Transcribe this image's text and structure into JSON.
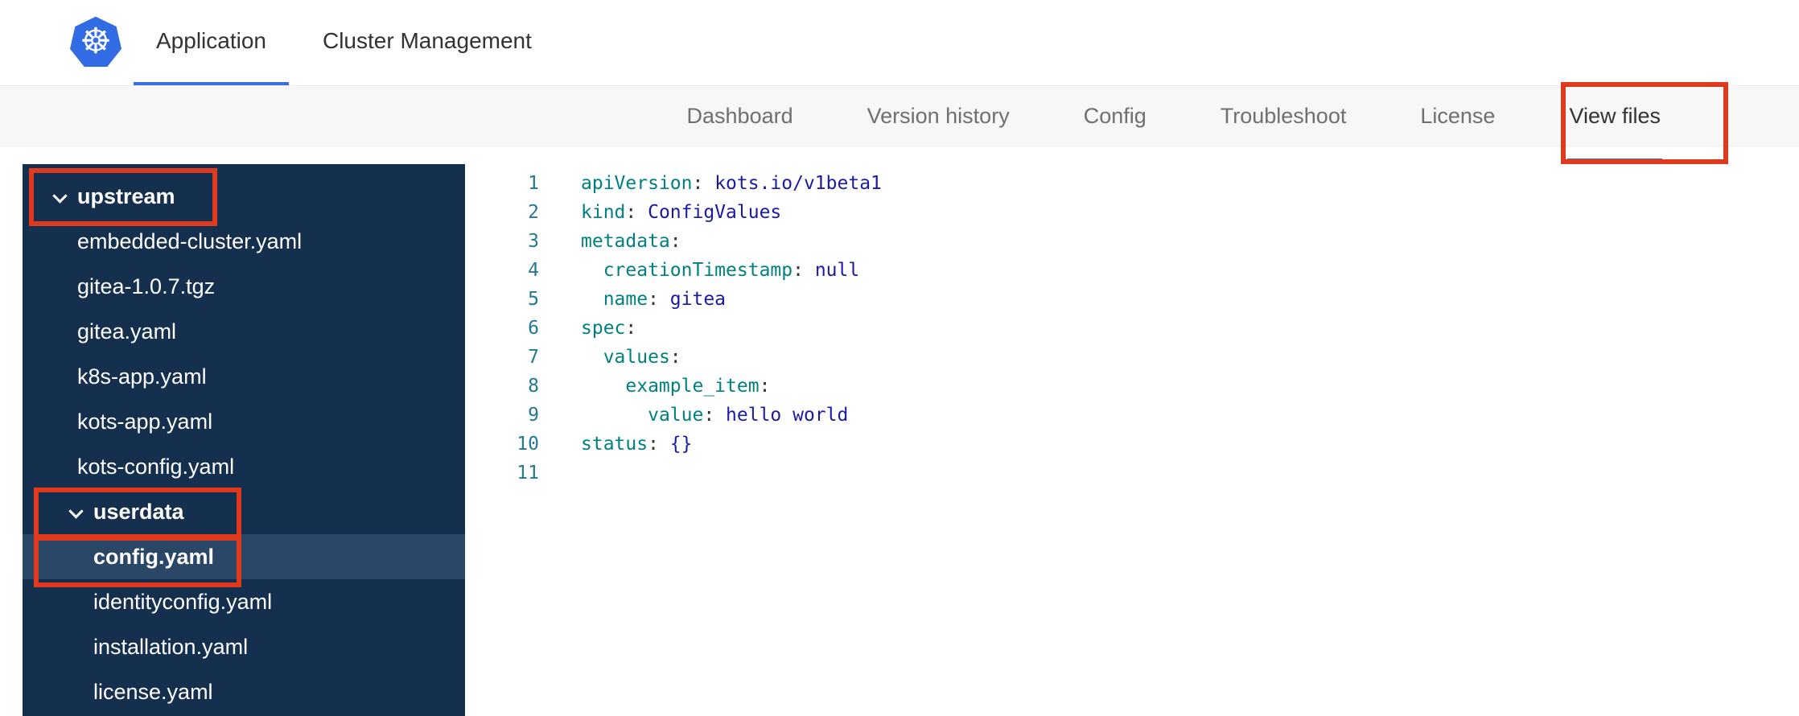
{
  "colors": {
    "accent_blue": "#3b6fe0",
    "annotation_red": "#e03a1e",
    "kubernetes_blue": "#326ce5",
    "sidebar_bg": "#15304f",
    "sidebar_selected": "#2a4768",
    "code_key": "#008080",
    "code_value": "#1a1aa6",
    "code_plain": "#333333",
    "line_number": "#237893"
  },
  "header": {
    "logo_glyph": "☸",
    "tabs": [
      {
        "label": "Application",
        "active": true
      },
      {
        "label": "Cluster Management",
        "active": false
      }
    ]
  },
  "subnav": {
    "tabs": [
      {
        "label": "Dashboard",
        "active": false
      },
      {
        "label": "Version history",
        "active": false
      },
      {
        "label": "Config",
        "active": false
      },
      {
        "label": "Troubleshoot",
        "active": false
      },
      {
        "label": "License",
        "active": false
      },
      {
        "label": "View files",
        "active": true,
        "annotated": true
      }
    ]
  },
  "file_tree": {
    "items": [
      {
        "type": "folder",
        "label": "upstream",
        "level": 0,
        "expanded": true,
        "annotated": true
      },
      {
        "type": "file",
        "label": "embedded-cluster.yaml",
        "level": 0
      },
      {
        "type": "file",
        "label": "gitea-1.0.7.tgz",
        "level": 0
      },
      {
        "type": "file",
        "label": "gitea.yaml",
        "level": 0
      },
      {
        "type": "file",
        "label": "k8s-app.yaml",
        "level": 0
      },
      {
        "type": "file",
        "label": "kots-app.yaml",
        "level": 0
      },
      {
        "type": "file",
        "label": "kots-config.yaml",
        "level": 0
      },
      {
        "type": "folder",
        "label": "userdata",
        "level": 1,
        "expanded": true,
        "annotated": true
      },
      {
        "type": "file",
        "label": "config.yaml",
        "level": 1,
        "selected": true,
        "annotated": true
      },
      {
        "type": "file",
        "label": "identityconfig.yaml",
        "level": 1
      },
      {
        "type": "file",
        "label": "installation.yaml",
        "level": 1
      },
      {
        "type": "file",
        "label": "license.yaml",
        "level": 1
      }
    ]
  },
  "editor": {
    "lines": [
      {
        "n": "1",
        "tokens": [
          {
            "t": "key",
            "v": "apiVersion"
          },
          {
            "t": "p",
            "v": ": "
          },
          {
            "t": "val",
            "v": "kots.io/v1beta1"
          }
        ]
      },
      {
        "n": "2",
        "tokens": [
          {
            "t": "key",
            "v": "kind"
          },
          {
            "t": "p",
            "v": ": "
          },
          {
            "t": "val",
            "v": "ConfigValues"
          }
        ]
      },
      {
        "n": "3",
        "tokens": [
          {
            "t": "key",
            "v": "metadata"
          },
          {
            "t": "p",
            "v": ":"
          }
        ]
      },
      {
        "n": "4",
        "tokens": [
          {
            "t": "p",
            "v": "  "
          },
          {
            "t": "key",
            "v": "creationTimestamp"
          },
          {
            "t": "p",
            "v": ": "
          },
          {
            "t": "val",
            "v": "null"
          }
        ]
      },
      {
        "n": "5",
        "tokens": [
          {
            "t": "p",
            "v": "  "
          },
          {
            "t": "key",
            "v": "name"
          },
          {
            "t": "p",
            "v": ": "
          },
          {
            "t": "val",
            "v": "gitea"
          }
        ]
      },
      {
        "n": "6",
        "tokens": [
          {
            "t": "key",
            "v": "spec"
          },
          {
            "t": "p",
            "v": ":"
          }
        ]
      },
      {
        "n": "7",
        "tokens": [
          {
            "t": "p",
            "v": "  "
          },
          {
            "t": "key",
            "v": "values"
          },
          {
            "t": "p",
            "v": ":"
          }
        ]
      },
      {
        "n": "8",
        "tokens": [
          {
            "t": "p",
            "v": "    "
          },
          {
            "t": "key",
            "v": "example_item"
          },
          {
            "t": "p",
            "v": ":"
          }
        ]
      },
      {
        "n": "9",
        "tokens": [
          {
            "t": "p",
            "v": "      "
          },
          {
            "t": "key",
            "v": "value"
          },
          {
            "t": "p",
            "v": ": "
          },
          {
            "t": "val",
            "v": "hello world"
          }
        ]
      },
      {
        "n": "10",
        "tokens": [
          {
            "t": "key",
            "v": "status"
          },
          {
            "t": "p",
            "v": ": "
          },
          {
            "t": "val",
            "v": "{}"
          }
        ]
      },
      {
        "n": "11",
        "tokens": []
      }
    ]
  }
}
